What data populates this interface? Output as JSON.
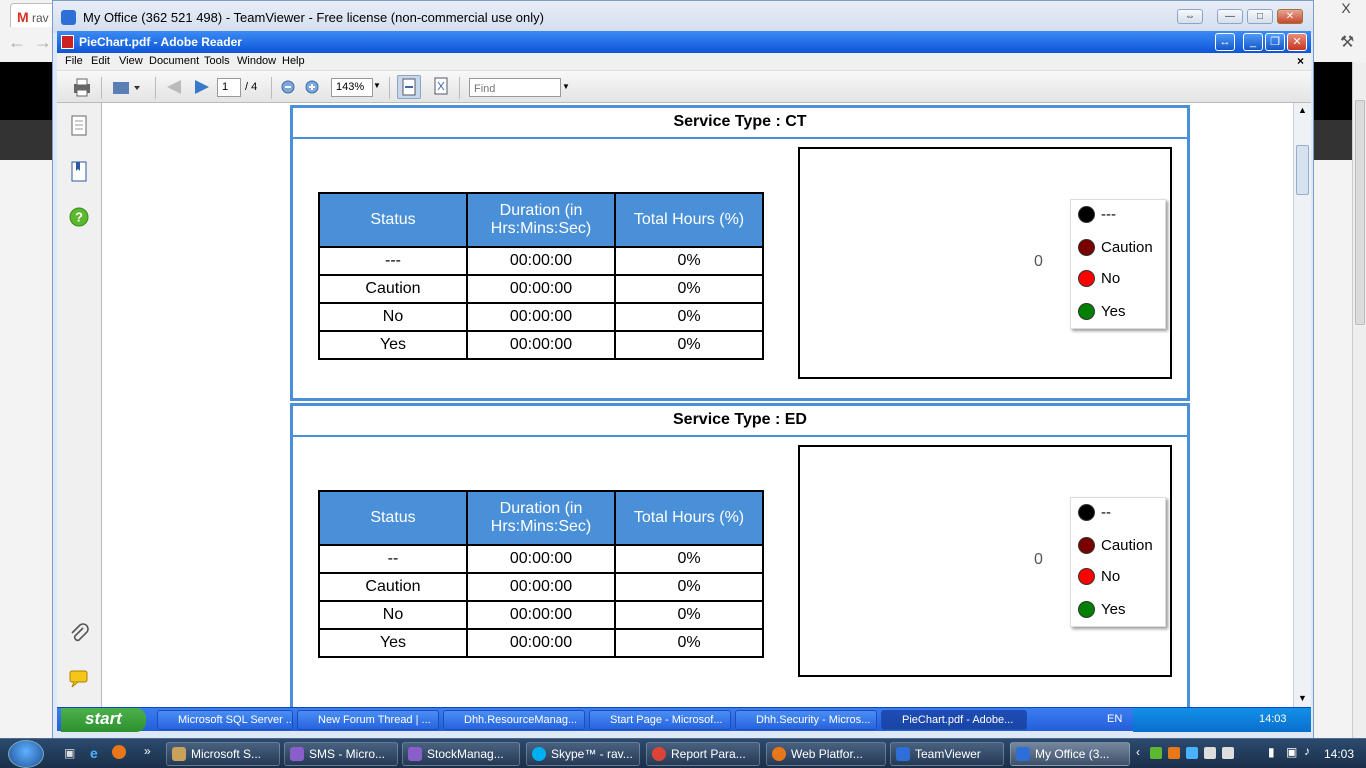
{
  "outer_browser": {
    "tab_label": "rav",
    "close_glyph": "X"
  },
  "teamviewer": {
    "title": "My Office (362 521 498) - TeamViewer - Free license (non-commercial use only)"
  },
  "reader": {
    "title": "PieChart.pdf - Adobe Reader",
    "menu": [
      "File",
      "Edit",
      "View",
      "Document",
      "Tools",
      "Window",
      "Help"
    ],
    "doc_close": "×",
    "page_current": "1",
    "page_total": "/ 4",
    "zoom": "143%",
    "find_placeholder": "Find"
  },
  "sections": [
    {
      "title": "Service Type : CT",
      "headers": [
        "Status",
        "Duration (in Hrs:Mins:Sec)",
        "Total Hours (%)"
      ],
      "rows": [
        [
          "---",
          "00:00:00",
          "0%"
        ],
        [
          "Caution",
          "00:00:00",
          "0%"
        ],
        [
          "No",
          "00:00:00",
          "0%"
        ],
        [
          "Yes",
          "00:00:00",
          "0%"
        ]
      ],
      "chart_value_label": "0",
      "legend": [
        {
          "label": "---",
          "color": "#000000"
        },
        {
          "label": "Caution",
          "color": "#7a0000"
        },
        {
          "label": "No",
          "color": "#ff0000"
        },
        {
          "label": "Yes",
          "color": "#008000"
        }
      ]
    },
    {
      "title": "Service Type : ED",
      "headers": [
        "Status",
        "Duration (in Hrs:Mins:Sec)",
        "Total Hours (%)"
      ],
      "rows": [
        [
          "--",
          "00:00:00",
          "0%"
        ],
        [
          "Caution",
          "00:00:00",
          "0%"
        ],
        [
          "No",
          "00:00:00",
          "0%"
        ],
        [
          "Yes",
          "00:00:00",
          "0%"
        ]
      ],
      "chart_value_label": "0",
      "legend": [
        {
          "label": "--",
          "color": "#000000"
        },
        {
          "label": "Caution",
          "color": "#7a0000"
        },
        {
          "label": "No",
          "color": "#ff0000"
        },
        {
          "label": "Yes",
          "color": "#008000"
        }
      ]
    }
  ],
  "inner_taskbar": {
    "start": "start",
    "items": [
      "Microsoft SQL Server ...",
      "New Forum Thread | ...",
      "Dhh.ResourceManag...",
      "Start Page - Microsof...",
      "Dhh.Security - Micros...",
      "PieChart.pdf - Adobe..."
    ],
    "lang": "EN",
    "time": "14:03"
  },
  "outer_taskbar": {
    "items": [
      "Microsoft S...",
      "SMS - Micro...",
      "StockManag...",
      "Skype™ - rav...",
      "Report Para...",
      "Web Platfor...",
      "TeamViewer",
      "My Office (3..."
    ],
    "time": "14:03"
  },
  "colors": {
    "table_header": "#4a90d9",
    "section_border": "#4a90d9",
    "reader_title": "#0c55d8"
  }
}
